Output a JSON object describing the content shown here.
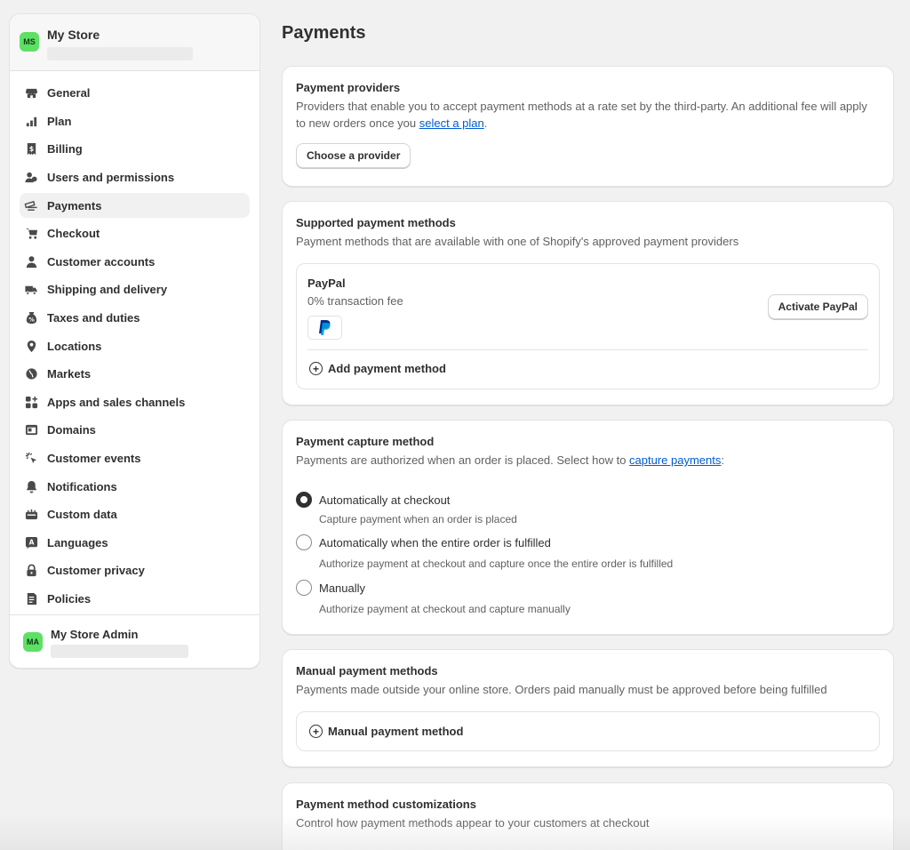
{
  "sidebar": {
    "store_initials": "MS",
    "store_name": "My Store",
    "items": [
      {
        "label": "General",
        "icon": "store-icon"
      },
      {
        "label": "Plan",
        "icon": "plan-icon"
      },
      {
        "label": "Billing",
        "icon": "receipt-icon"
      },
      {
        "label": "Users and permissions",
        "icon": "users-icon"
      },
      {
        "label": "Payments",
        "icon": "payments-icon",
        "active": true
      },
      {
        "label": "Checkout",
        "icon": "cart-icon"
      },
      {
        "label": "Customer accounts",
        "icon": "person-icon"
      },
      {
        "label": "Shipping and delivery",
        "icon": "truck-icon"
      },
      {
        "label": "Taxes and duties",
        "icon": "tax-icon"
      },
      {
        "label": "Locations",
        "icon": "location-pin-icon"
      },
      {
        "label": "Markets",
        "icon": "globe-icon"
      },
      {
        "label": "Apps and sales channels",
        "icon": "apps-icon"
      },
      {
        "label": "Domains",
        "icon": "domain-icon"
      },
      {
        "label": "Customer events",
        "icon": "cursor-click-icon"
      },
      {
        "label": "Notifications",
        "icon": "bell-icon"
      },
      {
        "label": "Custom data",
        "icon": "database-icon"
      },
      {
        "label": "Languages",
        "icon": "language-icon"
      },
      {
        "label": "Customer privacy",
        "icon": "lock-icon"
      },
      {
        "label": "Policies",
        "icon": "policy-icon"
      }
    ],
    "footer": {
      "initials": "MA",
      "name": "My Store Admin"
    }
  },
  "page": {
    "title": "Payments"
  },
  "providers": {
    "title": "Payment providers",
    "desc_before": "Providers that enable you to accept payment methods at a rate set by the third-party. An additional fee will apply to new orders once you ",
    "desc_link": "select a plan",
    "desc_after": ".",
    "button": "Choose a provider"
  },
  "supported": {
    "title": "Supported payment methods",
    "desc": "Payment methods that are available with one of Shopify's approved payment providers",
    "paypal_name": "PayPal",
    "paypal_fee": "0% transaction fee",
    "activate_button": "Activate PayPal",
    "add_method": "Add payment method"
  },
  "capture": {
    "title": "Payment capture method",
    "desc_before": "Payments are authorized when an order is placed. Select how to ",
    "desc_link": "capture payments",
    "desc_after": ":",
    "options": [
      {
        "label": "Automatically at checkout",
        "help": "Capture payment when an order is placed",
        "selected": true
      },
      {
        "label": "Automatically when the entire order is fulfilled",
        "help": "Authorize payment at checkout and capture once the entire order is fulfilled",
        "selected": false
      },
      {
        "label": "Manually",
        "help": "Authorize payment at checkout and capture manually",
        "selected": false
      }
    ]
  },
  "manual": {
    "title": "Manual payment methods",
    "desc": "Payments made outside your online store. Orders paid manually must be approved before being fulfilled",
    "add_method": "Manual payment method"
  },
  "customizations": {
    "title": "Payment method customizations",
    "desc": "Control how payment methods appear to your customers at checkout"
  },
  "colors": {
    "accent_link": "#005bd3",
    "avatar_green": "#5ee065",
    "text": "#303030",
    "muted": "#616161"
  }
}
